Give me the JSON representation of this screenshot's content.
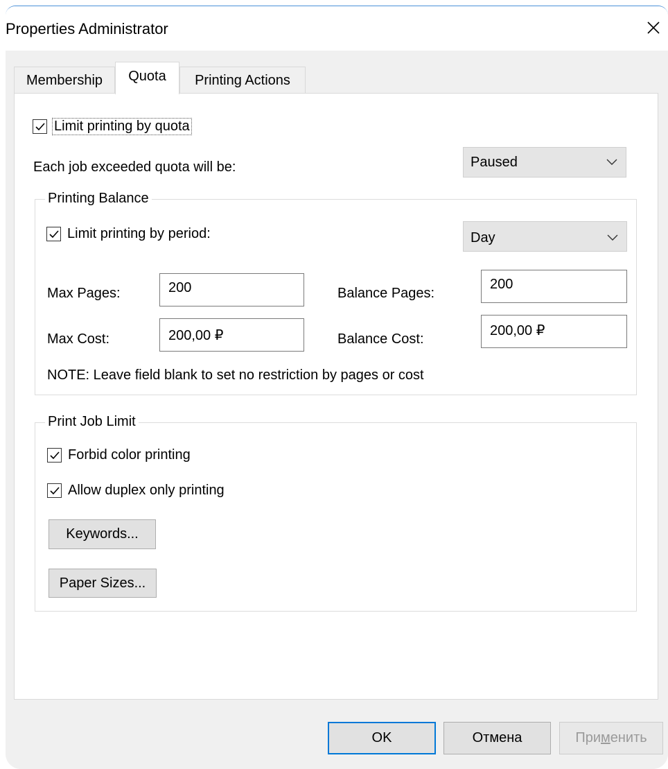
{
  "window": {
    "title": "Properties Administrator"
  },
  "tabs": [
    {
      "label": "Membership",
      "active": false
    },
    {
      "label": "Quota",
      "active": true
    },
    {
      "label": "Printing Actions",
      "active": false
    }
  ],
  "quota": {
    "limit_by_quota": {
      "label": "Limit printing by quota",
      "checked": true
    },
    "exceeded_label": "Each job exceeded quota will be:",
    "exceeded_value": "Paused"
  },
  "printing_balance": {
    "legend": "Printing Balance",
    "limit_by_period": {
      "label": "Limit printing by period:",
      "checked": true
    },
    "period_value": "Day",
    "max_pages_label": "Max Pages:",
    "max_pages_value": "200",
    "balance_pages_label": "Balance Pages:",
    "balance_pages_value": "200",
    "max_cost_label": "Max Cost:",
    "max_cost_value": "200,00 ₽",
    "balance_cost_label": "Balance Cost:",
    "balance_cost_value": "200,00 ₽",
    "note": "NOTE: Leave field blank to set no restriction by pages or cost"
  },
  "print_job_limit": {
    "legend": "Print Job Limit",
    "forbid_color": {
      "label": "Forbid color printing",
      "checked": true
    },
    "duplex_only": {
      "label": "Allow duplex only printing",
      "checked": true
    },
    "keywords_button": "Keywords...",
    "paper_sizes_button": "Paper Sizes..."
  },
  "footer": {
    "ok_label": "OK",
    "cancel_label": "Отмена",
    "apply_label_pre": "При",
    "apply_label_mnemonic": "м",
    "apply_label_post": "енить"
  },
  "icons": {
    "close": "close-icon",
    "checkbox_check": "check-icon",
    "dropdown": "chevron-down-icon"
  },
  "colors": {
    "accent": "#0078d7",
    "window_bg": "#f0f0f0",
    "panel_bg": "#ffffff"
  }
}
